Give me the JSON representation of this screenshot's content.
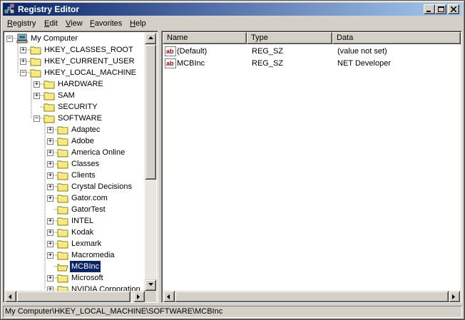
{
  "window": {
    "title": "Registry Editor"
  },
  "menu": [
    {
      "label": "Registry",
      "accel": "R",
      "rest": "egistry"
    },
    {
      "label": "Edit",
      "accel": "E",
      "rest": "dit"
    },
    {
      "label": "View",
      "accel": "V",
      "rest": "iew"
    },
    {
      "label": "Favorites",
      "accel": "F",
      "rest": "avorites"
    },
    {
      "label": "Help",
      "accel": "H",
      "rest": "elp"
    }
  ],
  "tree": {
    "root": "My Computer",
    "items": [
      {
        "label": "HKEY_CLASSES_ROOT",
        "expander": "+"
      },
      {
        "label": "HKEY_CURRENT_USER",
        "expander": "+"
      },
      {
        "label": "HKEY_LOCAL_MACHINE",
        "expander": "-"
      },
      {
        "label": "HARDWARE",
        "expander": "+"
      },
      {
        "label": "SAM",
        "expander": "+"
      },
      {
        "label": "SECURITY",
        "expander": ""
      },
      {
        "label": "SOFTWARE",
        "expander": "-"
      },
      {
        "label": "Adaptec",
        "expander": "+"
      },
      {
        "label": "Adobe",
        "expander": "+"
      },
      {
        "label": "America Online",
        "expander": "+"
      },
      {
        "label": "Classes",
        "expander": "+"
      },
      {
        "label": "Clients",
        "expander": "+"
      },
      {
        "label": "Crystal Decisions",
        "expander": "+"
      },
      {
        "label": "Gator.com",
        "expander": "+"
      },
      {
        "label": "GatorTest",
        "expander": ""
      },
      {
        "label": "INTEL",
        "expander": "+"
      },
      {
        "label": "Kodak",
        "expander": "+"
      },
      {
        "label": "Lexmark",
        "expander": "+"
      },
      {
        "label": "Macromedia",
        "expander": "+"
      },
      {
        "label": "MCBInc",
        "expander": "",
        "selected": true
      },
      {
        "label": "Microsoft",
        "expander": "+"
      },
      {
        "label": "NVIDIA Corporation",
        "expander": "+"
      }
    ]
  },
  "list": {
    "columns": [
      "Name",
      "Type",
      "Data"
    ],
    "rows": [
      {
        "name": "(Default)",
        "type": "REG_SZ",
        "data": "(value not set)"
      },
      {
        "name": "MCBInc",
        "type": "REG_SZ",
        "data": "NET Developer"
      }
    ]
  },
  "statusbar": {
    "text": "My Computer\\HKEY_LOCAL_MACHINE\\SOFTWARE\\MCBInc"
  },
  "colors": {
    "title_start": "#0a246a",
    "title_end": "#a6caf0",
    "selection": "#0a246a",
    "face": "#d4d0c8",
    "folder": "#ffe97f"
  },
  "icons": {
    "app": "registry-editor-icon",
    "computer": "computer-icon",
    "folder": "folder-icon",
    "value": "string-value-icon"
  }
}
